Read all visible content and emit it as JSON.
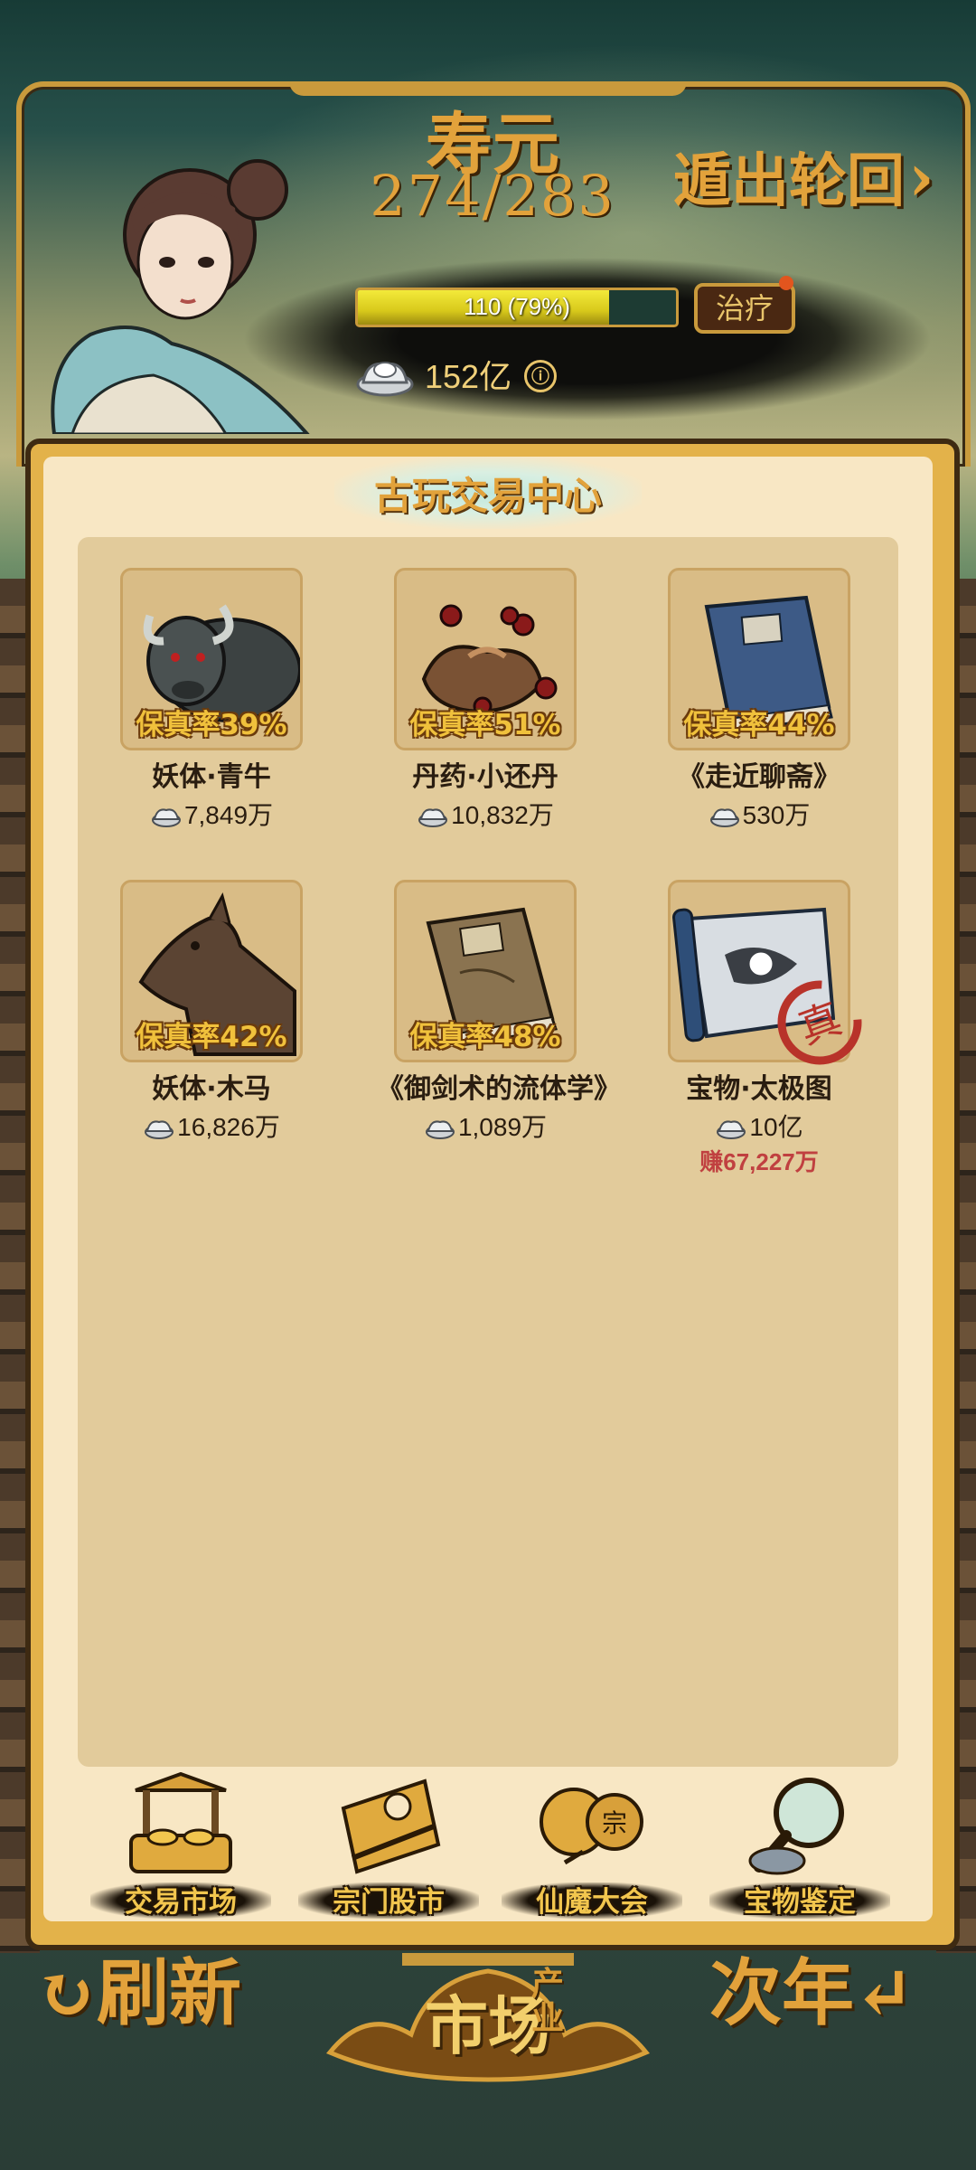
{
  "header": {
    "lifespan_label": "寿元",
    "lifespan_value": "274/283",
    "escape_label": "遁出轮回",
    "hp_text": "110 (79%)",
    "hp_fraction": 0.79,
    "heal_label": "治疗",
    "money": "152亿",
    "info_icon": "ⓘ"
  },
  "panel": {
    "title": "古玩交易中心"
  },
  "items": [
    {
      "authentic": "保真率39%",
      "name": "妖体·青牛",
      "price": "7,849万",
      "icon": "bull-icon"
    },
    {
      "authentic": "保真率51%",
      "name": "丹药·小还丹",
      "price": "10,832万",
      "icon": "pill-pouch-icon"
    },
    {
      "authentic": "保真率44%",
      "name": "《走近聊斋》",
      "price": "530万",
      "icon": "book-icon"
    },
    {
      "authentic": "保真率42%",
      "name": "妖体·木马",
      "price": "16,826万",
      "icon": "horse-icon"
    },
    {
      "authentic": "保真率48%",
      "name": "《御剑术的流体学》",
      "price": "1,089万",
      "icon": "book-icon"
    },
    {
      "authentic": "",
      "name": "宝物·太极图",
      "price": "10亿",
      "earn": "赚67,227万",
      "stamp": "真",
      "icon": "scroll-icon"
    }
  ],
  "nav": [
    {
      "label": "交易市场",
      "icon": "market-stall-icon"
    },
    {
      "label": "宗门股市",
      "icon": "stock-scroll-icon"
    },
    {
      "label": "仙魔大会",
      "icon": "gourd-icon"
    },
    {
      "label": "宝物鉴定",
      "icon": "magnifier-icon"
    }
  ],
  "footer": {
    "refresh": "刷新",
    "refresh_prefix": "↻",
    "next_year": "次年",
    "next_year_suffix": "↵",
    "market": "市场",
    "market_sub": "产业"
  },
  "colors": {
    "gold": "#e2a23b",
    "panel_bg": "#f8e7c4",
    "grid_bg": "#e2cb9b",
    "earn": "#c04040"
  }
}
